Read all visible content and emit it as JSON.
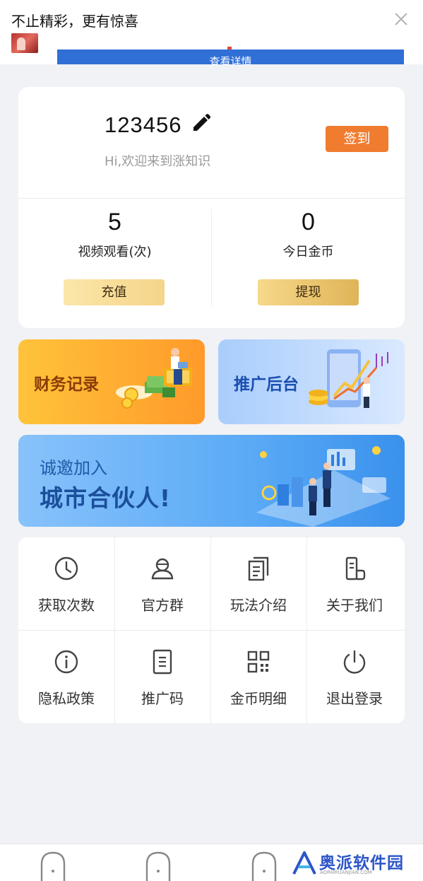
{
  "ad": {
    "title": "不止精彩，更有惊喜",
    "cta": "查看详情"
  },
  "user": {
    "id": "123456",
    "greeting": "Hi,欢迎来到涨知识",
    "signin_label": "签到"
  },
  "stats": [
    {
      "value": "5",
      "label": "视频观看(次)",
      "button": "充值"
    },
    {
      "value": "0",
      "label": "今日金币",
      "button": "提现"
    }
  ],
  "tiles": {
    "finance": "财务记录",
    "promo": "推广后台"
  },
  "partner": {
    "sub": "诚邀加入",
    "main": "城市合伙人!"
  },
  "menu": [
    {
      "label": "获取次数",
      "icon": "clock-icon"
    },
    {
      "label": "官方群",
      "icon": "group-icon"
    },
    {
      "label": "玩法介绍",
      "icon": "document-icon"
    },
    {
      "label": "关于我们",
      "icon": "info-card-icon"
    },
    {
      "label": "隐私政策",
      "icon": "info-icon"
    },
    {
      "label": "推广码",
      "icon": "promo-code-icon"
    },
    {
      "label": "金币明细",
      "icon": "qr-code-icon"
    },
    {
      "label": "退出登录",
      "icon": "power-icon"
    }
  ],
  "watermark": {
    "text": "奥派软件园",
    "sub": "AOPAIRUANJIAN.COM"
  },
  "colors": {
    "signin": "#f07c30",
    "finance_tile": "#ffa82d",
    "promo_tile": "#b8d6fd",
    "partner_banner": "#5aaaf6",
    "page_bg": "#f1f2f5"
  }
}
